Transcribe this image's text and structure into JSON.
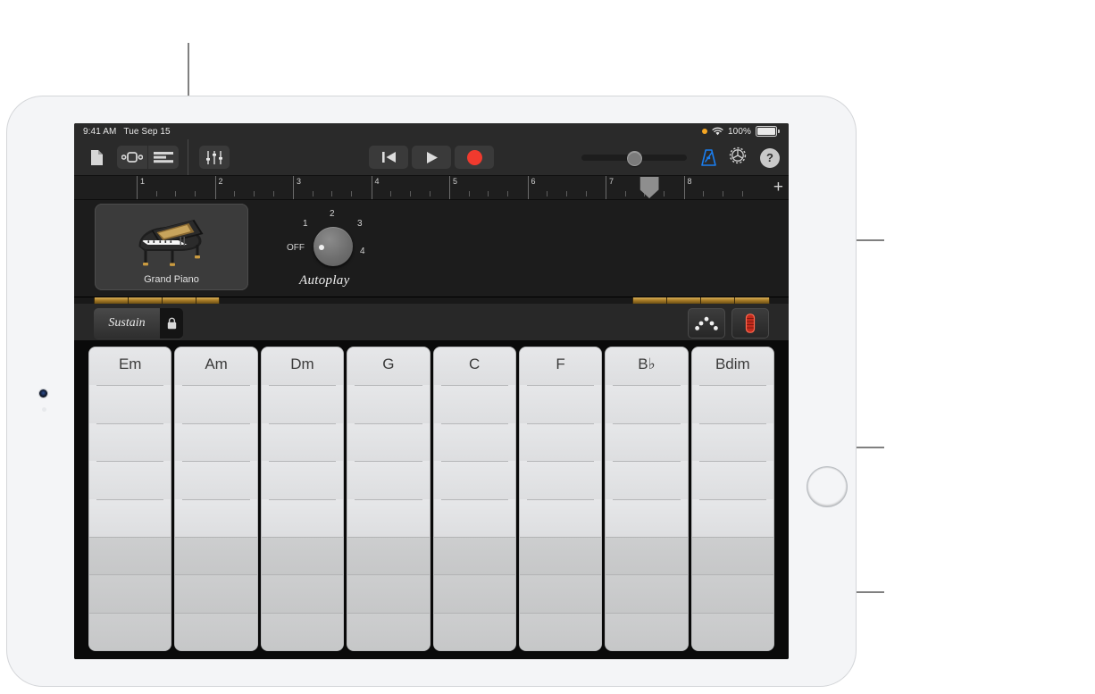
{
  "status_bar": {
    "time": "9:41 AM",
    "date": "Tue Sep 15",
    "battery": "100%",
    "orange_dot": "recording-indicator",
    "wifi": "wifi-icon"
  },
  "toolbar": {
    "browser_label": "document-icon",
    "view_toggle_a": "track-view-icon",
    "view_toggle_b": "tracks-list-icon",
    "mixer_label": "mixer-sliders-icon",
    "rewind_label": "rewind-to-start",
    "play_label": "play",
    "record_label": "record",
    "volume_value": 45,
    "metronome_label": "metronome",
    "settings_label": "settings",
    "help_label": "?"
  },
  "ruler": {
    "bars": [
      "1",
      "2",
      "3",
      "4",
      "5",
      "6",
      "7",
      "8"
    ],
    "playhead_bar": 7.5,
    "add_section_label": "+"
  },
  "panel": {
    "instrument_name": "Grand Piano",
    "autoplay": {
      "title": "Autoplay",
      "value": "OFF",
      "positions": [
        "OFF",
        "1",
        "2",
        "3",
        "4"
      ]
    }
  },
  "control_bar": {
    "sustain_label": "Sustain",
    "lock_label": "lock-icon",
    "chords_button": "chord-dots-icon",
    "notes_button": "note-strip-icon"
  },
  "chords": {
    "upper_segments": 5,
    "lower_segments": 3,
    "strips": [
      {
        "name": "Em"
      },
      {
        "name": "Am"
      },
      {
        "name": "Dm"
      },
      {
        "name": "G"
      },
      {
        "name": "C"
      },
      {
        "name": "F"
      },
      {
        "name": "B♭"
      },
      {
        "name": "Bdim"
      }
    ]
  },
  "colors": {
    "record_red": "#f03a2e",
    "metronome_blue": "#1a7ef0",
    "accent_gold": "#a97d28",
    "strip_light": "#e3e4e6",
    "strip_dark": "#c8c9ca",
    "callout_gray": "#808080"
  }
}
